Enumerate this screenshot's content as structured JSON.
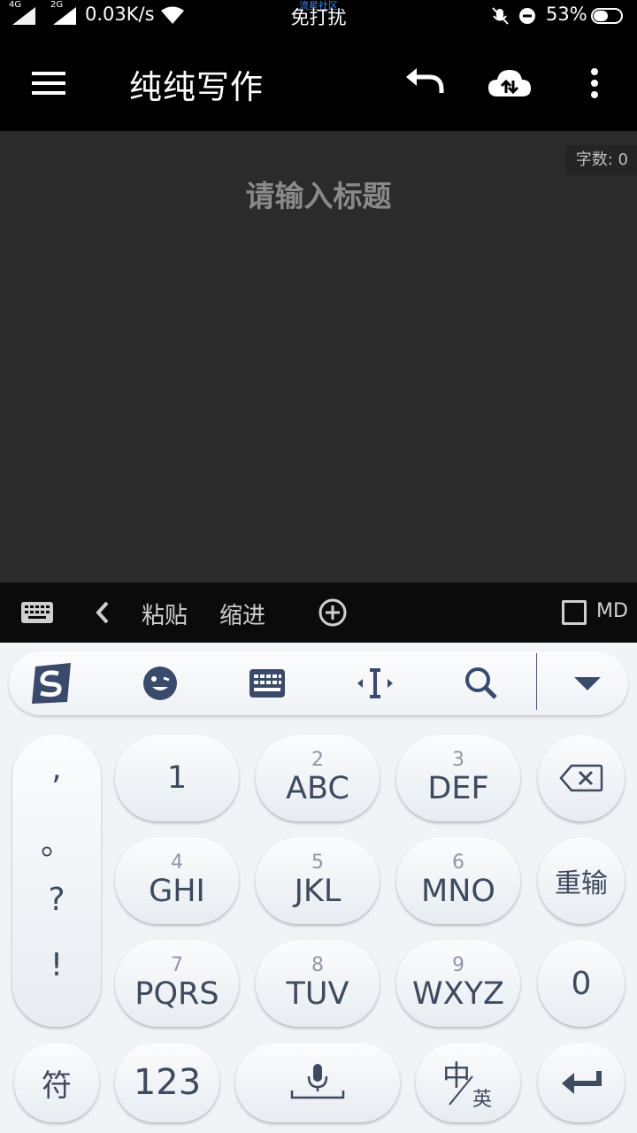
{
  "status_bar": {
    "network_1": "4G",
    "network_2": "2G",
    "speed": "0.03K/s",
    "center_top": "流星社区",
    "center": "免打扰",
    "battery": "53%"
  },
  "toolbar": {
    "menu_icon": "hamburger-menu-icon",
    "title": "纯纯写作",
    "undo_icon": "undo-icon",
    "cloud_icon": "cloud-sync-icon",
    "more_icon": "more-vertical-icon"
  },
  "editor": {
    "word_count": "字数: 0",
    "title_placeholder": "请输入标题"
  },
  "edit_bar": {
    "keyboard_icon": "keyboard-icon",
    "back_icon": "chevron-left-icon",
    "paste": "粘贴",
    "indent": "缩进",
    "add_icon": "plus-circle-icon",
    "md_label": "MD",
    "md_checked": false
  },
  "keyboard": {
    "top_bar_icons": [
      "sogou-logo-icon",
      "emoji-icon",
      "keyboard-switch-icon",
      "cursor-move-icon",
      "search-icon",
      "collapse-down-icon"
    ],
    "punctuation": [
      ",",
      "。",
      "?",
      "!"
    ],
    "keys": [
      {
        "num": "",
        "label": "1"
      },
      {
        "num": "2",
        "label": "ABC"
      },
      {
        "num": "3",
        "label": "DEF"
      },
      {
        "num": "4",
        "label": "GHI"
      },
      {
        "num": "5",
        "label": "JKL"
      },
      {
        "num": "6",
        "label": "MNO"
      },
      {
        "num": "7",
        "label": "PQRS"
      },
      {
        "num": "8",
        "label": "TUV"
      },
      {
        "num": "9",
        "label": "WXYZ"
      }
    ],
    "reinput": "重输",
    "zero": "0",
    "symbols": "符",
    "numbers": "123",
    "lang_zh": "中",
    "lang_en": "英",
    "colors": {
      "key_text": "#3e4a5e",
      "accent": "#2f3f5f"
    }
  }
}
